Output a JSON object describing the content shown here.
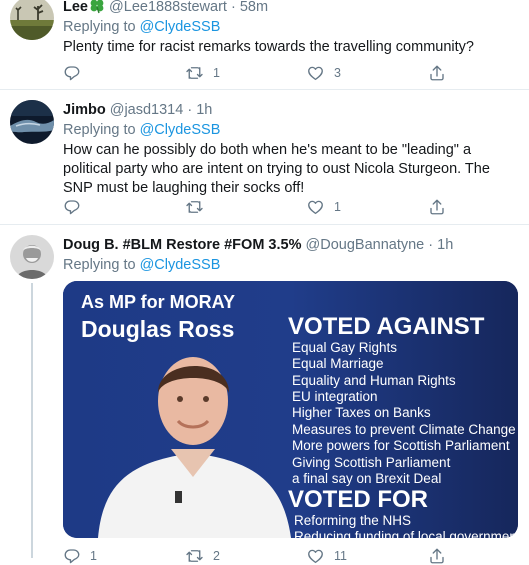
{
  "tweets": [
    {
      "display_name": "Lee",
      "badge_icon": "four-leaf-clover-emoji",
      "handle": "@Lee1888stewart",
      "separator": "·",
      "time": "58m",
      "replying_prefix": "Replying to",
      "replying_handle": "@ClydeSSB",
      "text": "Plenty time for racist remarks towards the travelling community?",
      "retweets": "1",
      "likes": "3"
    },
    {
      "display_name": "Jimbo",
      "handle": "@jasd1314",
      "separator": "·",
      "time": "1h",
      "replying_prefix": "Replying to",
      "replying_handle": "@ClydeSSB",
      "text": "How can he possibly do both when he's meant to be \"leading\" a political party who are intent on trying to oust Nicola Sturgeon. The SNP must be laughing their socks off!",
      "likes": "1"
    },
    {
      "display_name": "Doug B. #BLM Restore #FOM 3.5%",
      "handle": "@DougBannatyne",
      "separator": "·",
      "time": "1h",
      "replying_prefix": "Replying to",
      "replying_handle": "@ClydeSSB",
      "replies": "1",
      "retweets": "2",
      "likes": "11",
      "media": {
        "heading_line1": "As MP for MORAY",
        "heading_line2": "Douglas Ross",
        "voted_against_title": "VOTED AGAINST",
        "voted_against_items": [
          "Equal Gay Rights",
          "Equal Marriage",
          "Equality and Human Rights",
          "EU integration",
          "Higher Taxes on Banks",
          "Measures to prevent Climate Change",
          "More powers for Scottish Parliament",
          "Giving Scottish Parliament",
          "a final say on Brexit Deal"
        ],
        "voted_for_title": "VOTED FOR",
        "voted_for_items": [
          "Reforming the NHS",
          "Reducing funding of local government"
        ]
      }
    }
  ],
  "colors": {
    "text": "#14171a",
    "muted": "#657786",
    "link": "#1b95e0",
    "divider": "#e6ecf0",
    "media_bg": "#1a2f6b"
  }
}
